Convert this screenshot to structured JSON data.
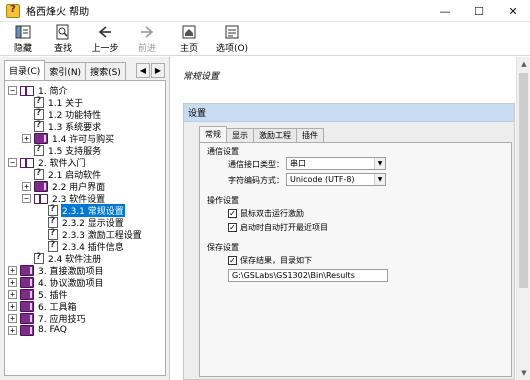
{
  "window": {
    "title": "格西烽火 帮助",
    "controls": {
      "minimize": "—",
      "maximize": "☐",
      "close": "✕"
    }
  },
  "toolbar": {
    "buttons": [
      {
        "label": "隐藏",
        "icon": "hide-icon"
      },
      {
        "label": "查找",
        "icon": "find-icon"
      },
      {
        "label": "上一步",
        "icon": "back-arrow-icon"
      },
      {
        "label": "前进",
        "icon": "forward-arrow-icon",
        "disabled": true
      },
      {
        "label": "主页",
        "icon": "home-icon"
      },
      {
        "label": "选项(O)",
        "icon": "options-icon"
      }
    ]
  },
  "nav_tabs": [
    {
      "label": "目录(C)"
    },
    {
      "label": "索引(N)"
    },
    {
      "label": "搜索(S)"
    }
  ],
  "nav_arrows": {
    "left": "◀",
    "right": "▶"
  },
  "tree": [
    {
      "label": "1. 简介",
      "type": "book-open",
      "expander": "−"
    },
    {
      "label": "1.1 关于",
      "type": "page"
    },
    {
      "label": "1.2 功能特性",
      "type": "page"
    },
    {
      "label": "1.3 系统要求",
      "type": "page"
    },
    {
      "label": "1.4 许可与购买",
      "type": "book-closed",
      "expander": "+"
    },
    {
      "label": "1.5 支持服务",
      "type": "page"
    },
    {
      "label": "2. 软件入门",
      "type": "book-open",
      "expander": "−"
    },
    {
      "label": "2.1 启动软件",
      "type": "page"
    },
    {
      "label": "2.2 用户界面",
      "type": "book-closed",
      "expander": "+"
    },
    {
      "label": "2.3 软件设置",
      "type": "book-open",
      "expander": "−"
    },
    {
      "label": "2.3.1 常规设置",
      "type": "page",
      "selected": true
    },
    {
      "label": "2.3.2 显示设置",
      "type": "page"
    },
    {
      "label": "2.3.3 激励工程设置",
      "type": "page"
    },
    {
      "label": "2.3.4 插件信息",
      "type": "page"
    },
    {
      "label": "2.4 软件注册",
      "type": "page"
    },
    {
      "label": "3. 直接激励项目",
      "type": "book-closed",
      "expander": "+"
    },
    {
      "label": "4. 协议激励项目",
      "type": "book-closed",
      "expander": "+"
    },
    {
      "label": "5. 插件",
      "type": "book-closed",
      "expander": "+"
    },
    {
      "label": "6. 工具箱",
      "type": "book-closed",
      "expander": "+"
    },
    {
      "label": "7. 应用技巧",
      "type": "book-closed",
      "expander": "+"
    },
    {
      "label": "8. FAQ",
      "type": "book-closed",
      "expander": "+"
    }
  ],
  "content": {
    "heading": "常规设置",
    "settings_title": "设置",
    "tabs": [
      "常规",
      "显示",
      "激励工程",
      "插件"
    ],
    "comm": {
      "group": "通信设置",
      "port_label": "通信接口类型：",
      "port_value": "串口",
      "encoding_label": "字符编码方式：",
      "encoding_value": "Unicode (UTF-8)"
    },
    "operation": {
      "group": "操作设置",
      "opt1": "鼠标双击运行激励",
      "opt2": "启动时自动打开最近项目"
    },
    "save": {
      "group": "保存设置",
      "opt1": "保存结果，目录如下",
      "path": "G:\\GSLabs\\GS1302\\Bin\\Results"
    },
    "check_mark": "✓"
  }
}
